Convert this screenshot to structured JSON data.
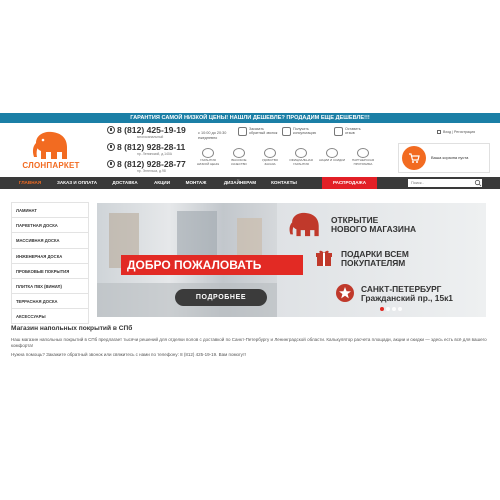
{
  "topbar": {
    "text": "ГАРАНТИЯ САМОЙ НИЗКОЙ ЦЕНЫ! НАШЛИ ДЕШЕВЛЕ? ПРОДАДИМ ЕЩЕ ДЕШЕВЛЕ!!!"
  },
  "logo": {
    "text": "СЛОНПАРКЕТ",
    "icon": "elephant-logo",
    "color": "#f26b21"
  },
  "phones": [
    {
      "number": "8 (812) 425-19-19",
      "caption": "многоканальный"
    },
    {
      "number": "8 (812) 928-28-11",
      "caption": "пр. Ленинский, д.140А"
    },
    {
      "number": "8 (812) 928-28-77",
      "caption": "пр. Энгельса, д.98"
    }
  ],
  "hours": {
    "line1": "с 10:00 до 20:30",
    "line2": "ежедневно"
  },
  "features": [
    {
      "text": "Заказать обратный звонок",
      "icon": "phone-icon"
    },
    {
      "text": "Получить консультацию",
      "icon": "chat-icon"
    },
    {
      "text": "Оставить отзыв",
      "icon": "review-icon"
    }
  ],
  "badges": [
    {
      "text": "ГАРАНТИЯ НИЗКОЙ ЦЕНЫ",
      "icon": "price-icon"
    },
    {
      "text": "ВЫСОКОЕ КАЧЕСТВО",
      "icon": "quality-icon"
    },
    {
      "text": "УДОБСТВО ЗАКАЗА",
      "icon": "order-icon"
    },
    {
      "text": "ОФИЦИАЛЬНАЯ ГАРАНТИЯ",
      "icon": "warranty-icon"
    },
    {
      "text": "АКЦИИ И СКИДКИ",
      "icon": "discount-icon"
    },
    {
      "text": "ПАРТНЕРСКАЯ ПРОГРАММА",
      "icon": "partner-icon"
    }
  ],
  "auth": {
    "text": "Вход | Регистрация",
    "icon": "lock-icon"
  },
  "cart": {
    "text": "Ваша корзина пуста",
    "icon": "cart-icon"
  },
  "nav": {
    "items": [
      "ГЛАВНАЯ",
      "ЗАКАЗ И ОПЛАТА",
      "ДОСТАВКА",
      "АКЦИИ",
      "МОНТАЖ",
      "ДИЗАЙНЕРАМ",
      "КОНТАКТЫ",
      "РАСПРОДАЖА"
    ],
    "search_placeholder": "Поиск.."
  },
  "sidebar": {
    "items": [
      "ЛАМИНАТ",
      "ПАРКЕТНАЯ ДОСКА",
      "МАССИВНАЯ ДОСКА",
      "ИНЖЕНЕРНАЯ ДОСКА",
      "ПРОБКОВЫЕ ПОКРЫТИЯ",
      "ПЛИТКА ПВХ (ВИНИЛ)",
      "ТЕРРАСНАЯ ДОСКА",
      "АКСЕССУАРЫ"
    ]
  },
  "banner": {
    "welcome": "ДОБРО ПОЖАЛОВАТЬ",
    "button": "ПОДРОБНЕЕ",
    "promo1": [
      "ОТКРЫТИЕ",
      "НОВОГО МАГАЗИНА"
    ],
    "promo2": [
      "ПОДАРКИ ВСЕМ",
      "ПОКУПАТЕЛЯМ"
    ],
    "promo3": [
      "САНКТ-ПЕТЕРБУРГ",
      "Гражданский пр., 15к1"
    ],
    "accent": "#e22a24"
  },
  "content": {
    "title": "Магазин напольных покрытий в СПб",
    "p1": "Наш магазин напольных покрытий в СПб предлагает тысячи решений для отделки полов с доставкой по Санкт-Петербургу и Ленинградской области. Калькулятор расчета площади, акции и скидки — здесь есть всё для вашего комфорта!",
    "p2": "Нужна помощь? Закажите обратный звонок или свяжитесь с нами по телефону: 8 (812) 425-19-19. Вам помогут!"
  }
}
